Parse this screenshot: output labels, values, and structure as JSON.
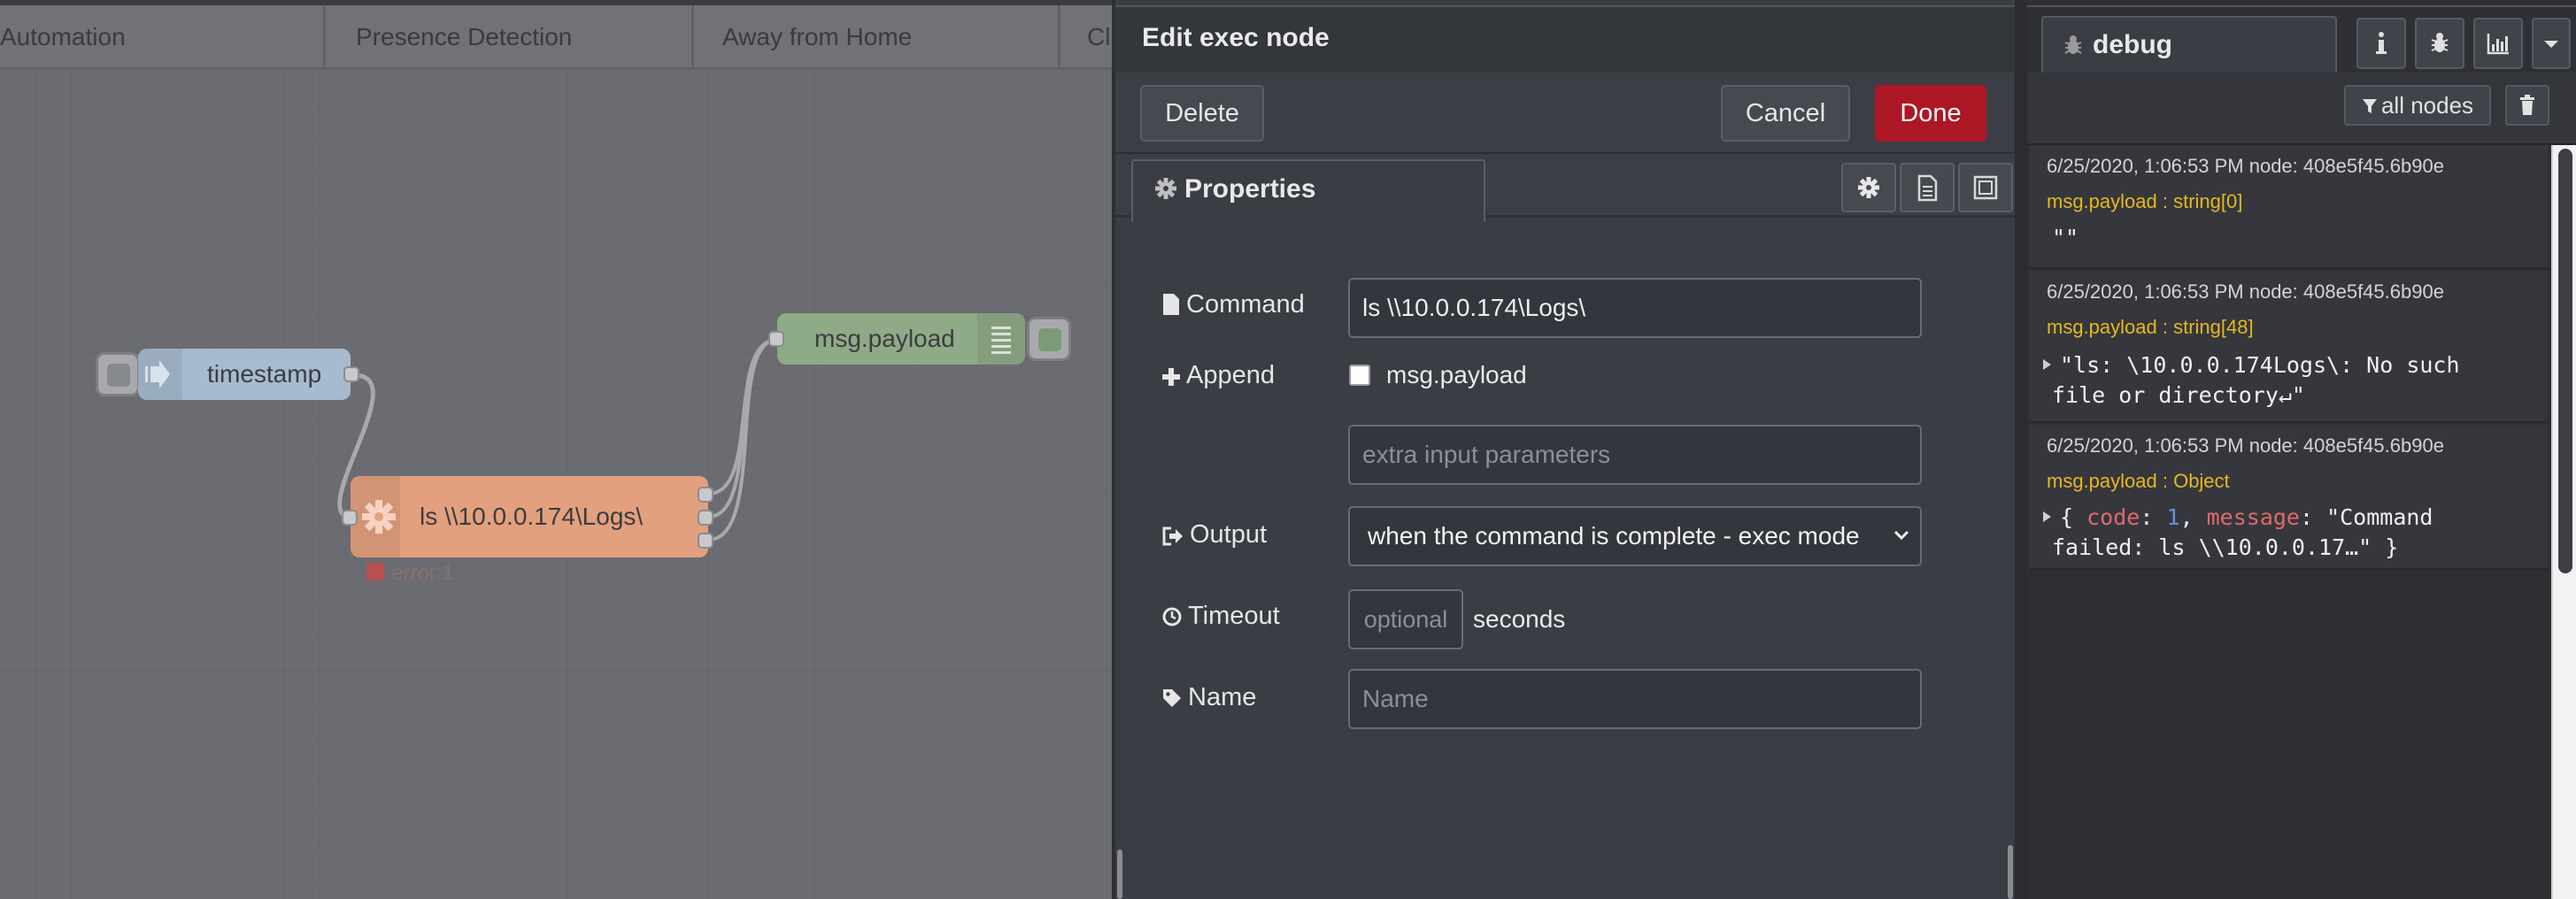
{
  "workspace": {
    "tabs": [
      "Automation",
      "Presence Detection",
      "Away from Home",
      "Cl"
    ],
    "nodes": {
      "inject_label": "timestamp",
      "exec_label": "ls \\\\10.0.0.174\\Logs\\",
      "exec_status": "error:1",
      "debug_label": "msg.payload"
    },
    "colors": {
      "inject": "#a6bbcf",
      "exec": "#ea9a7a",
      "debug": "#87a980",
      "status_error": "#c24040"
    }
  },
  "editor": {
    "title": "Edit exec node",
    "delete_label": "Delete",
    "cancel_label": "Cancel",
    "done_label": "Done",
    "properties_tab": "Properties",
    "icons": [
      "gear-icon",
      "description-icon",
      "appearance-icon"
    ],
    "fields": {
      "command_label": "Command",
      "command_value": "ls \\\\10.0.0.174\\Logs\\",
      "append_label": "Append",
      "append_checkbox_label": "msg.payload",
      "append_checked": false,
      "extra_placeholder": "extra input parameters",
      "output_label": "Output",
      "output_value": "when the command is complete - exec mode",
      "timeout_label": "Timeout",
      "timeout_placeholder": "optional",
      "timeout_unit": "seconds",
      "name_label": "Name",
      "name_placeholder": "Name"
    },
    "colors": {
      "done": "#ad1625"
    }
  },
  "sidebar": {
    "tab_label": "debug",
    "icons": [
      "info-icon",
      "bug-icon",
      "chart-icon",
      "dropdown-caret-icon"
    ],
    "filter_label": "all nodes",
    "messages": [
      {
        "meta": "6/25/2020, 1:06:53 PM   node: 408e5f45.6b90e",
        "topic": "msg.payload : string[0]",
        "body": "\"\""
      },
      {
        "meta": "6/25/2020, 1:06:53 PM   node: 408e5f45.6b90e",
        "topic": "msg.payload : string[48]",
        "body_line1": "\"ls: \\10.0.0.174Logs\\: No such",
        "body_line2": "file or directory↵\""
      },
      {
        "meta": "6/25/2020, 1:06:53 PM   node: 408e5f45.6b90e",
        "topic": "msg.payload : Object",
        "obj_open": "{ ",
        "key1": "code",
        "sep1": ": ",
        "val1": "1",
        "comma1": ", ",
        "key2": "message",
        "sep2": ": ",
        "val2_line1": "\"Command",
        "val2_line2": "failed: ls \\\\10.0.0.17…\" }"
      }
    ],
    "colors": {
      "topic": "#e6b81f",
      "key": "#e06a6a",
      "number": "#6a8be8"
    }
  }
}
